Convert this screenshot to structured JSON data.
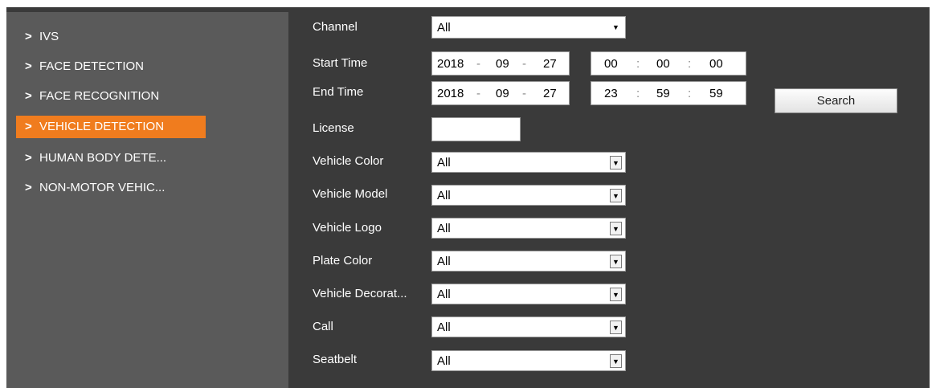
{
  "sidebar": {
    "items": [
      {
        "label": "IVS",
        "active": false
      },
      {
        "label": "FACE DETECTION",
        "active": false
      },
      {
        "label": "FACE RECOGNITION",
        "active": false
      },
      {
        "label": "VEHICLE DETECTION",
        "active": true
      },
      {
        "label": "HUMAN BODY DETE...",
        "active": false
      },
      {
        "label": "NON-MOTOR VEHIC...",
        "active": false
      }
    ],
    "chevron": ">",
    "active_color": "#f07c1e"
  },
  "form": {
    "channel": {
      "label": "Channel",
      "value": "All"
    },
    "start_time": {
      "label": "Start Time",
      "year": "2018",
      "month": "09",
      "day": "27",
      "hour": "00",
      "minute": "00",
      "second": "00"
    },
    "end_time": {
      "label": "End Time",
      "year": "2018",
      "month": "09",
      "day": "27",
      "hour": "23",
      "minute": "59",
      "second": "59"
    },
    "license": {
      "label": "License",
      "value": ""
    },
    "vehicle_color": {
      "label": "Vehicle Color",
      "value": "All"
    },
    "vehicle_model": {
      "label": "Vehicle Model",
      "value": "All"
    },
    "vehicle_logo": {
      "label": "Vehicle Logo",
      "value": "All"
    },
    "plate_color": {
      "label": "Plate Color",
      "value": "All"
    },
    "vehicle_decoration": {
      "label": "Vehicle Decorat...",
      "value": "All"
    },
    "call": {
      "label": "Call",
      "value": "All"
    },
    "seatbelt": {
      "label": "Seatbelt",
      "value": "All"
    },
    "date_sep": "-",
    "time_sep": ":",
    "dropdown_arrow": "▼"
  },
  "search_button": {
    "label": "Search"
  }
}
